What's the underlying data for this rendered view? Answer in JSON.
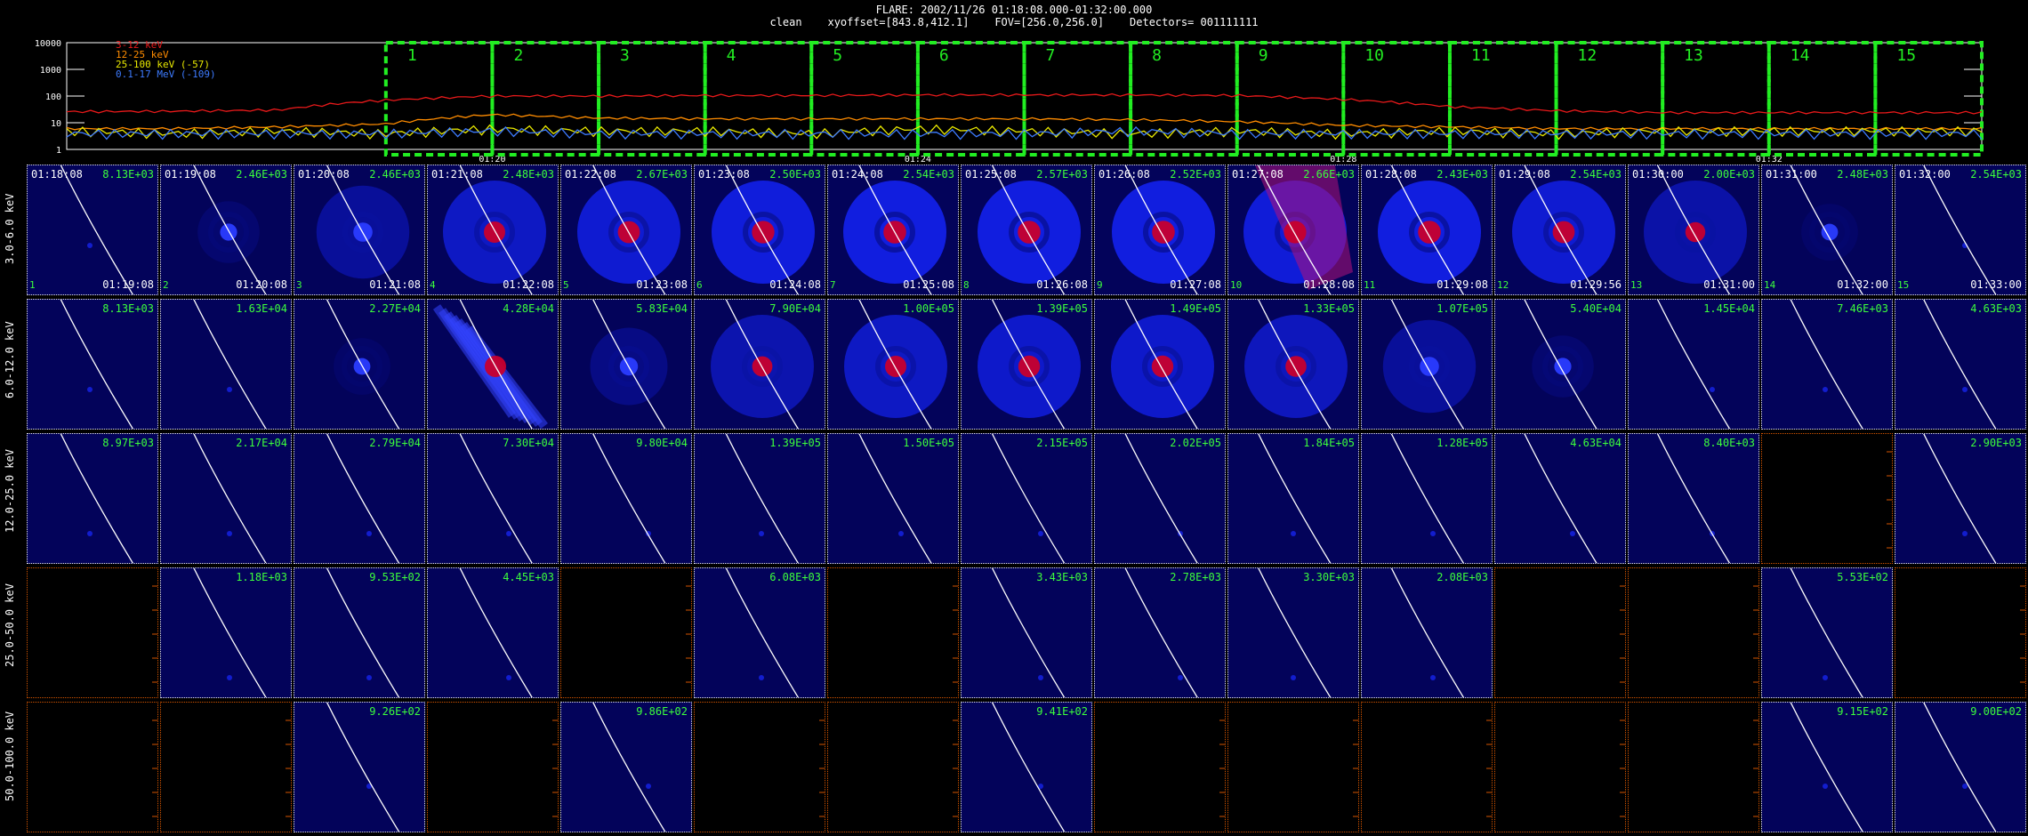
{
  "header": {
    "title": "FLARE: 2002/11/26 01:18:08.000-01:32:00.000",
    "subtitle": "clean    xyoffset=[843.8,412.1]    FOV=[256.0,256.0]    Detectors= 001111111"
  },
  "colors": {
    "background": "#000000",
    "image_bg": "#03035a",
    "box_green": "#22ee22",
    "count_green": "#3cff3c",
    "empty_border": "#d35400"
  },
  "chart_data": [
    {
      "type": "line",
      "y_scale": "log",
      "ylim": [
        1,
        10000
      ],
      "yticks": [
        "10000",
        "1000",
        "100",
        "10",
        "1"
      ],
      "xticks": [
        "01:20",
        "01:24",
        "01:28",
        "01:32"
      ],
      "xlim_minutes": [
        0,
        30
      ],
      "xtick_minutes": [
        8,
        16,
        24,
        32
      ],
      "legend": "top-left",
      "series": [
        {
          "name": "3-12 keV",
          "color": "#e8191a",
          "x_minutes": [
            0,
            2,
            4,
            6,
            8,
            10,
            12,
            14,
            16,
            18,
            20,
            22,
            24,
            26,
            28,
            30
          ],
          "values": [
            26,
            27,
            30,
            70,
            100,
            100,
            105,
            105,
            110,
            110,
            110,
            105,
            75,
            40,
            28,
            24
          ]
        },
        {
          "name": "12-25 keV",
          "color": "#ff8c00",
          "x_minutes": [
            0,
            2,
            4,
            6,
            8,
            10,
            12,
            14,
            16,
            18,
            20,
            22,
            24,
            26,
            28,
            30
          ],
          "values": [
            6,
            6,
            7,
            9,
            20,
            15,
            14,
            14,
            14,
            14,
            13,
            11,
            8,
            7,
            6,
            6
          ]
        },
        {
          "name": "25-100 keV (-57)",
          "color": "#e8e800",
          "x_minutes": [
            0,
            2,
            4,
            6,
            8,
            10,
            12,
            14,
            16,
            18,
            20,
            22,
            24,
            26,
            28,
            30
          ],
          "values": [
            5,
            4,
            5,
            4,
            6,
            5,
            5,
            4,
            6,
            5,
            4,
            5,
            4,
            5,
            4,
            5
          ]
        },
        {
          "name": "0.1-17 MeV (-109)",
          "color": "#3d7bff",
          "x_minutes": [
            0,
            2,
            4,
            6,
            8,
            10,
            12,
            14,
            16,
            18,
            20,
            22,
            24,
            26,
            28,
            30
          ],
          "values": [
            4,
            4,
            4,
            4,
            5,
            4,
            4,
            4,
            4,
            4,
            5,
            4,
            4,
            4,
            4,
            4
          ]
        }
      ],
      "intervals": [
        "1",
        "2",
        "3",
        "4",
        "5",
        "6",
        "7",
        "8",
        "9",
        "10",
        "11",
        "12",
        "13",
        "14",
        "15"
      ],
      "interval_starts": [
        6,
        8,
        10,
        12,
        14,
        16,
        18,
        20,
        22,
        24,
        26,
        28,
        30,
        32,
        34
      ],
      "interval_ends": [
        8,
        10,
        12,
        14,
        16,
        18,
        20,
        22,
        24,
        26,
        28,
        30,
        32,
        34,
        36
      ]
    },
    {
      "type": "heatmap",
      "row_labels": [
        "3.0-6.0 keV",
        "6.0-12.0 keV",
        "12.0-25.0 keV",
        "25.0-50.0 keV",
        "50.0-100.0 keV"
      ],
      "start_times": [
        "01:18:08",
        "01:19:08",
        "01:20:08",
        "01:21:08",
        "01:22:08",
        "01:23:08",
        "01:24:08",
        "01:25:08",
        "01:26:08",
        "01:27:08",
        "01:28:08",
        "01:29:08",
        "01:30:00",
        "01:31:00",
        "01:32:00"
      ],
      "end_times": [
        "01:19:08",
        "01:20:08",
        "01:21:08",
        "01:22:08",
        "01:23:08",
        "01:24:08",
        "01:25:08",
        "01:26:08",
        "01:27:08",
        "01:28:08",
        "01:29:08",
        "01:29:56",
        "01:31:00",
        "01:32:00",
        "01:33:00"
      ],
      "counts": [
        [
          "8.13E+03",
          "2.46E+03",
          "2.46E+03",
          "2.48E+03",
          "2.67E+03",
          "2.50E+03",
          "2.54E+03",
          "2.57E+03",
          "2.52E+03",
          "2.66E+03",
          "2.43E+03",
          "2.54E+03",
          "2.00E+03",
          "2.48E+03",
          "2.54E+03"
        ],
        [
          "8.13E+03",
          "1.63E+04",
          "2.27E+04",
          "4.28E+04",
          "5.83E+04",
          "7.90E+04",
          "1.00E+05",
          "1.39E+05",
          "1.49E+05",
          "1.33E+05",
          "1.07E+05",
          "5.40E+04",
          "1.45E+04",
          "7.46E+03",
          "4.63E+03"
        ],
        [
          "8.97E+03",
          "2.17E+04",
          "2.79E+04",
          "7.30E+04",
          "9.80E+04",
          "1.39E+05",
          "1.50E+05",
          "2.15E+05",
          "2.02E+05",
          "1.84E+05",
          "1.28E+05",
          "4.63E+04",
          "8.40E+03",
          "",
          "2.90E+03"
        ],
        [
          "",
          "1.18E+03",
          "9.53E+02",
          "4.45E+03",
          "",
          "6.08E+03",
          "",
          "3.43E+03",
          "2.78E+03",
          "3.30E+03",
          "2.08E+03",
          "",
          "",
          "5.53E+02",
          ""
        ],
        [
          "",
          "",
          "9.26E+02",
          "",
          "9.86E+02",
          "",
          "",
          "9.41E+02",
          "",
          "",
          "",
          "",
          "",
          "9.15E+02",
          "9.00E+02"
        ]
      ],
      "intensity": [
        [
          0.05,
          0.15,
          0.45,
          0.75,
          0.85,
          0.92,
          0.95,
          0.95,
          0.95,
          0.9,
          0.95,
          0.85,
          0.55,
          0.1,
          0.05
        ],
        [
          0.05,
          0.05,
          0.1,
          0.75,
          0.3,
          0.6,
          0.75,
          0.8,
          0.8,
          0.7,
          0.45,
          0.15,
          0.05,
          0.05,
          0.05
        ],
        [
          0.02,
          0.02,
          0.02,
          0.02,
          0.02,
          0.02,
          0.02,
          0.02,
          0.02,
          0.02,
          0.02,
          0.02,
          0.02,
          0,
          0.02
        ],
        [
          0,
          0.02,
          0.02,
          0.02,
          0,
          0.02,
          0,
          0.02,
          0.02,
          0.02,
          0.02,
          0,
          0,
          0.02,
          0
        ],
        [
          0,
          0,
          0.02,
          0,
          0.02,
          0,
          0,
          0.02,
          0,
          0,
          0,
          0,
          0,
          0.02,
          0.02
        ]
      ],
      "source_color": "#c8002d",
      "limb_color": "#ffffff"
    }
  ]
}
